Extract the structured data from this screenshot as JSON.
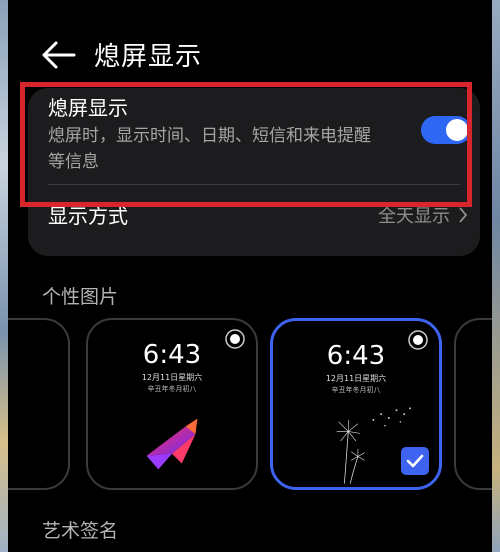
{
  "header": {
    "title": "熄屏显示"
  },
  "aod_setting": {
    "title": "熄屏显示",
    "description": "熄屏时，显示时间、日期、短信和来电提醒等信息",
    "enabled": true
  },
  "display_mode": {
    "label": "显示方式",
    "value": "全天显示"
  },
  "personal_pictures": {
    "title": "个性图片",
    "items": [
      {
        "name": "partial-left"
      },
      {
        "time": "6:43",
        "date": "12月11日星期六",
        "lunar": "辛丑年冬月初八",
        "art": "origami-bird",
        "selected": false
      },
      {
        "time": "6:43",
        "date": "12月11日星期六",
        "lunar": "辛丑年冬月初八",
        "art": "dandelion",
        "selected": true
      },
      {
        "name": "partial-right"
      }
    ]
  },
  "art_signature": {
    "title": "艺术签名"
  },
  "colors": {
    "accent": "#3d63f0",
    "toggle": "#2f67f5",
    "highlight": "#d8262d"
  }
}
